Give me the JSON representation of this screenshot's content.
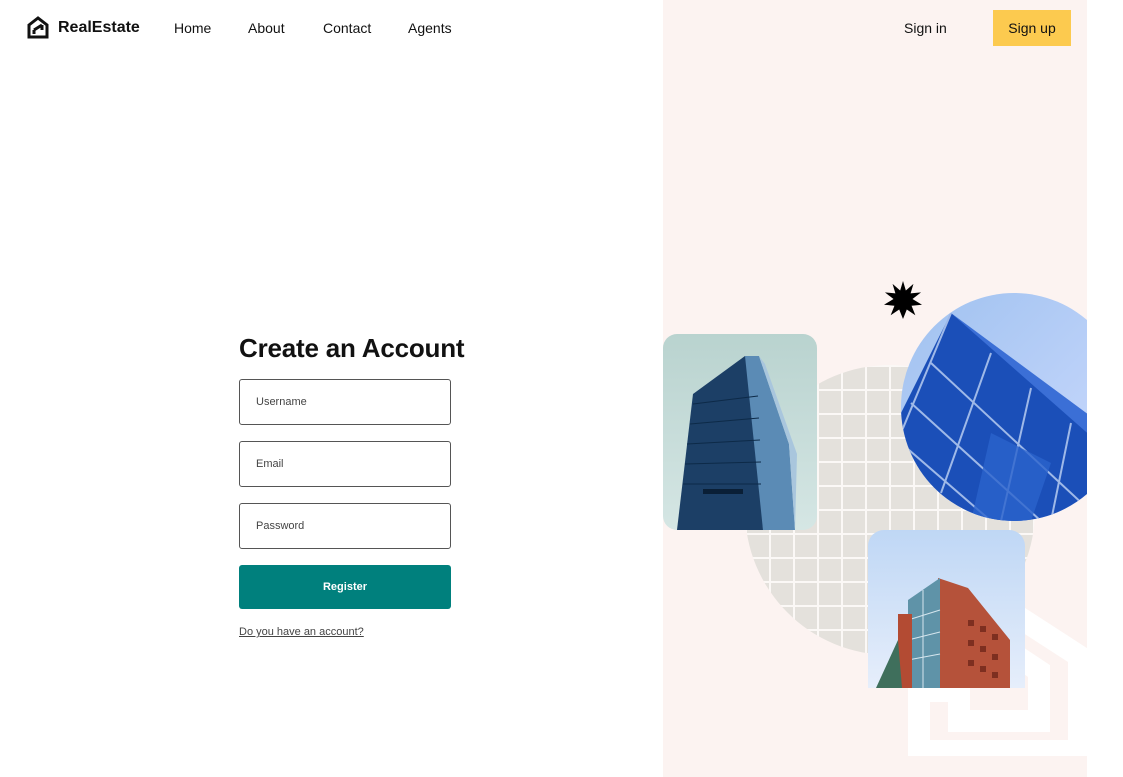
{
  "header": {
    "logo_text": "RealEstate",
    "nav": [
      {
        "label": "Home"
      },
      {
        "label": "About"
      },
      {
        "label": "Contact"
      },
      {
        "label": "Agents"
      }
    ],
    "signin_label": "Sign in",
    "signup_label": "Sign up"
  },
  "form": {
    "title": "Create an Account",
    "username_placeholder": "Username",
    "email_placeholder": "Email",
    "password_placeholder": "Password",
    "register_label": "Register",
    "account_link": "Do you have an account?"
  },
  "icons": {
    "logo": "realestate-logo-icon",
    "decoration": "starburst-icon"
  },
  "colors": {
    "accent_button": "#00807d",
    "signup_button": "#fcca4f",
    "side_panel": "#fcf3f1"
  }
}
